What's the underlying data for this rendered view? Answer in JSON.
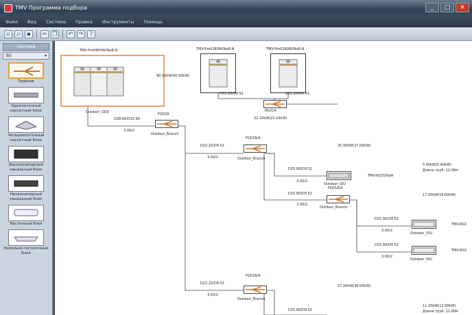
{
  "window": {
    "title": "TMV Программа подбора"
  },
  "menu": [
    "Файл",
    "Вид",
    "Система",
    "Правка",
    "Инструменты",
    "Помощь"
  ],
  "toolbar_icons": [
    "new-icon",
    "open-icon",
    "save-icon",
    "cut-icon",
    "copy-icon",
    "undo-icon",
    "redo-icon",
    "help-icon"
  ],
  "palette": {
    "header": "Система",
    "select_value": "BS",
    "items": [
      {
        "label": "Тройник",
        "icon": "branch-joint-icon",
        "active": true
      },
      {
        "label": "Однопоточный кассетный блок",
        "icon": "one-way-cassette-icon",
        "active": false
      },
      {
        "label": "Четырехпоточный кассетный блок",
        "icon": "four-way-cassette-icon",
        "active": false
      },
      {
        "label": "Высоконапорный канальный блок",
        "icon": "high-pressure-duct-icon",
        "active": false
      },
      {
        "label": "Низконапорный канальный блок",
        "icon": "low-pressure-duct-icon",
        "active": false
      },
      {
        "label": "Настенный блок",
        "icon": "wall-mounted-icon",
        "active": false
      },
      {
        "label": "Напольно-потолочный блок",
        "icon": "floor-ceiling-icon",
        "active": false
      }
    ]
  },
  "diagram": {
    "outdoor_main": {
      "model": "TMV-Pm0800W/NaB-N",
      "label": "Outdoor_ODU"
    },
    "outdoor_2": {
      "model": "TMV-Pm0280W/NaB-N"
    },
    "outdoor_3": {
      "model": "TMV-Pm0280W/NaB-N"
    },
    "cap_text": "90.00kW(90.00kW)",
    "pipe_a": "D28.60/D15.90",
    "pipe_a_len": "3.00/2",
    "joint_main": {
      "name": "FQ02A",
      "label": "Outdoor_Branch"
    },
    "joint_ml": {
      "name": "ML01A",
      "pipe": "D22.20/D9.52"
    },
    "joint_ml_cap": "22.10kW(22.10kW)",
    "pipe_b": "D22.20/D9.52",
    "pipe_b_len": "3.00/2",
    "joint_1": {
      "name": "FQ01B/A",
      "label": "Outdoor_Branch"
    },
    "cap_1": "25.00kW(27.00kW)",
    "indoor_1": {
      "pipe": "D15.90/D9.52",
      "len": "3.00/2",
      "model": "TMV-R025/NaH",
      "label": "Outdoor_IDU"
    },
    "info_1": {
      "cap": "5.00kW(5.60kW)",
      "length": "Длина труб: 12.00м"
    },
    "joint_2": {
      "name": "FQ01A/A",
      "pipe": "D15.90/D9.52",
      "len": "3.00/2",
      "label": "Outdoor_Branch"
    },
    "info_2": "17.00kW(19.00kW)",
    "indoor_2": {
      "pipe": "D15.90/D9.52",
      "len": "3.00/2",
      "model": "TMV-R02",
      "label": "Outdoor_IDU"
    },
    "indoor_3": {
      "pipe": "D15.90/D9.52",
      "len": "3.00/2",
      "model": "TMV-R02",
      "label": "Outdoor_IDU"
    },
    "pipe_c": "D22.20/D9.52",
    "pipe_c_len": "3.00/2",
    "joint_3": {
      "name": "FQ01B/A",
      "label": "Outdoor_Branch"
    },
    "cap_3": "27.00kW(30.00kW)",
    "pipe_d": "D15.90/D9.52",
    "info_3": {
      "cap": "11.20kW(12.00kW)",
      "length": "Длина труб: 11.00м"
    }
  }
}
